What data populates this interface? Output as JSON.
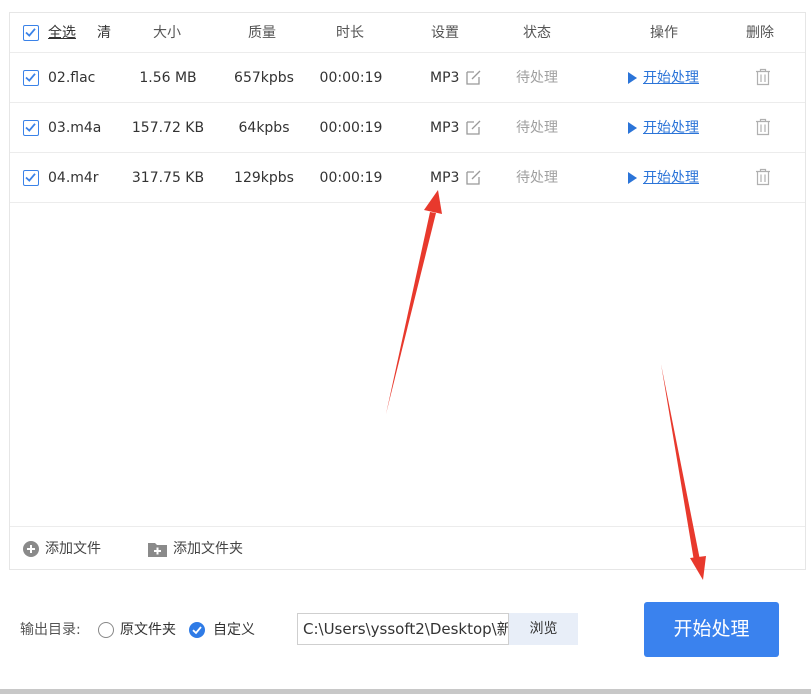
{
  "header": {
    "select_all": "全选",
    "clear": "清",
    "size": "大小",
    "quality": "质量",
    "duration": "时长",
    "settings": "设置",
    "status": "状态",
    "operation": "操作",
    "delete": "删除"
  },
  "files": [
    {
      "name": "02.flac",
      "size": "1.56 MB",
      "quality": "657kpbs",
      "duration": "00:00:19",
      "format": "MP3",
      "status": "待处理",
      "action": "开始处理",
      "checked": true
    },
    {
      "name": "03.m4a",
      "size": "157.72 KB",
      "quality": "64kpbs",
      "duration": "00:00:19",
      "format": "MP3",
      "status": "待处理",
      "action": "开始处理",
      "checked": true
    },
    {
      "name": "04.m4r",
      "size": "317.75 KB",
      "quality": "129kpbs",
      "duration": "00:00:19",
      "format": "MP3",
      "status": "待处理",
      "action": "开始处理",
      "checked": true
    }
  ],
  "toolbar": {
    "add_file": "添加文件",
    "add_folder": "添加文件夹"
  },
  "output": {
    "label": "输出目录:",
    "option_original": "原文件夹",
    "option_custom": "自定义",
    "selected": "custom",
    "path": "C:\\Users\\yssoft2\\Desktop\\新",
    "browse": "浏览",
    "start": "开始处理"
  },
  "colors": {
    "accent": "#3a82ee",
    "link": "#2b74d8",
    "annotation_arrow": "#e8392d"
  }
}
